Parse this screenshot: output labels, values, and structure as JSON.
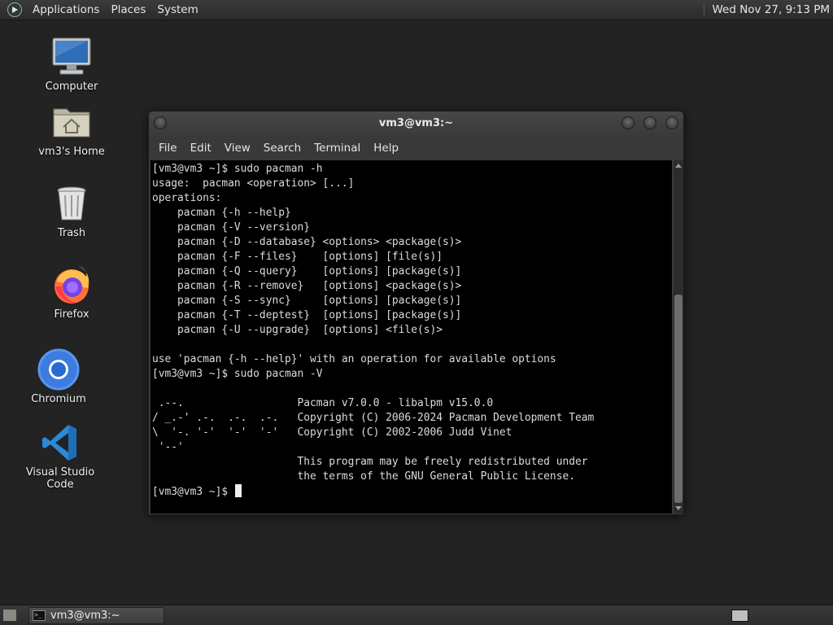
{
  "top_panel": {
    "menus": [
      "Applications",
      "Places",
      "System"
    ],
    "clock": "Wed Nov 27,  9:13 PM"
  },
  "desktop": {
    "icons": [
      {
        "label": "Computer",
        "icon": "computer-icon"
      },
      {
        "label": "vm3's Home",
        "icon": "home-folder-icon"
      },
      {
        "label": "Trash",
        "icon": "trash-icon"
      },
      {
        "label": "Firefox",
        "icon": "firefox-icon"
      },
      {
        "label": "Chromium",
        "icon": "chromium-icon"
      },
      {
        "label": "Visual Studio Code",
        "icon": "vscode-icon"
      }
    ]
  },
  "terminal": {
    "title": "vm3@vm3:~",
    "menus": [
      "File",
      "Edit",
      "View",
      "Search",
      "Terminal",
      "Help"
    ],
    "output": "[vm3@vm3 ~]$ sudo pacman -h\nusage:  pacman <operation> [...]\noperations:\n    pacman {-h --help}\n    pacman {-V --version}\n    pacman {-D --database} <options> <package(s)>\n    pacman {-F --files}    [options] [file(s)]\n    pacman {-Q --query}    [options] [package(s)]\n    pacman {-R --remove}   [options] <package(s)>\n    pacman {-S --sync}     [options] [package(s)]\n    pacman {-T --deptest}  [options] [package(s)]\n    pacman {-U --upgrade}  [options] <file(s)>\n\nuse 'pacman {-h --help}' with an operation for available options\n[vm3@vm3 ~]$ sudo pacman -V\n\n .--.                  Pacman v7.0.0 - libalpm v15.0.0\n/ _.-' .-.  .-.  .-.   Copyright (C) 2006-2024 Pacman Development Team\n\\  '-. '-'  '-'  '-'   Copyright (C) 2002-2006 Judd Vinet\n '--'\n                       This program may be freely redistributed under\n                       the terms of the GNU General Public License.\n",
    "prompt": "[vm3@vm3 ~]$ "
  },
  "taskbar": {
    "task_label": "vm3@vm3:~",
    "task_icon_text": ">_"
  },
  "colors": {
    "desktop_bg": "#232323",
    "terminal_bg": "#000000",
    "terminal_fg": "#dcdcdc"
  }
}
